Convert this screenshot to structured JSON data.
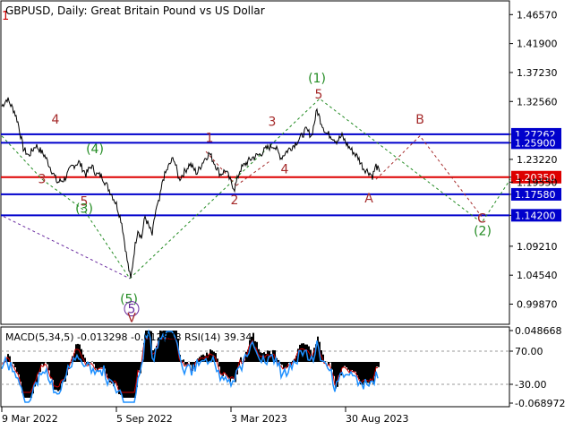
{
  "header": {
    "title": "GBPUSD, Daily:  Great Britain Pound vs US Dollar",
    "corner_mark": "1"
  },
  "colors": {
    "background": "#ffffff",
    "price": "#000000",
    "hline_blue": "#0000cc",
    "hline_red": "#dd0000",
    "wave_brown": "#a52a2a",
    "wave_green": "#228b22",
    "wave_purple": "#6a2ca0",
    "macd_hist": "#000000",
    "macd_signal": "#cc0000",
    "rsi": "#1e90ff"
  },
  "chart_data": [
    {
      "type": "line",
      "name": "main-price-chart",
      "ylim": [
        0.9662,
        1.4878
      ],
      "y_ticks": [
        "1.46570",
        "1.41900",
        "1.37230",
        "1.32560",
        "1.27262",
        "1.25900",
        "1.23220",
        "1.20350",
        "1.19550",
        "1.17580",
        "1.14200",
        "1.09210",
        "1.04540",
        "0.99870"
      ],
      "x_ticks": [
        "9 Mar 2022",
        "5 Sep 2022",
        "3 Mar 2023",
        "30 Aug 2023"
      ],
      "price_path": [
        {
          "i": 0,
          "y": 1.318
        },
        {
          "i": 6,
          "y": 1.33
        },
        {
          "i": 14,
          "y": 1.31
        },
        {
          "i": 18,
          "y": 1.292
        },
        {
          "i": 24,
          "y": 1.25
        },
        {
          "i": 30,
          "y": 1.238
        },
        {
          "i": 38,
          "y": 1.255
        },
        {
          "i": 48,
          "y": 1.238
        },
        {
          "i": 56,
          "y": 1.214
        },
        {
          "i": 62,
          "y": 1.195
        },
        {
          "i": 70,
          "y": 1.2
        },
        {
          "i": 78,
          "y": 1.22
        },
        {
          "i": 86,
          "y": 1.228
        },
        {
          "i": 94,
          "y": 1.208
        },
        {
          "i": 100,
          "y": 1.222
        },
        {
          "i": 106,
          "y": 1.208
        },
        {
          "i": 112,
          "y": 1.205
        },
        {
          "i": 118,
          "y": 1.188
        },
        {
          "i": 122,
          "y": 1.178
        },
        {
          "i": 128,
          "y": 1.16
        },
        {
          "i": 134,
          "y": 1.13
        },
        {
          "i": 140,
          "y": 1.07
        },
        {
          "i": 144,
          "y": 1.038
        },
        {
          "i": 148,
          "y": 1.085
        },
        {
          "i": 152,
          "y": 1.12
        },
        {
          "i": 156,
          "y": 1.105
        },
        {
          "i": 160,
          "y": 1.14
        },
        {
          "i": 164,
          "y": 1.125
        },
        {
          "i": 168,
          "y": 1.11
        },
        {
          "i": 172,
          "y": 1.15
        },
        {
          "i": 176,
          "y": 1.165
        },
        {
          "i": 180,
          "y": 1.2
        },
        {
          "i": 186,
          "y": 1.22
        },
        {
          "i": 192,
          "y": 1.235
        },
        {
          "i": 198,
          "y": 1.2
        },
        {
          "i": 204,
          "y": 1.212
        },
        {
          "i": 210,
          "y": 1.225
        },
        {
          "i": 218,
          "y": 1.21
        },
        {
          "i": 226,
          "y": 1.232
        },
        {
          "i": 232,
          "y": 1.242
        },
        {
          "i": 238,
          "y": 1.225
        },
        {
          "i": 244,
          "y": 1.208
        },
        {
          "i": 250,
          "y": 1.215
        },
        {
          "i": 256,
          "y": 1.195
        },
        {
          "i": 260,
          "y": 1.185
        },
        {
          "i": 266,
          "y": 1.215
        },
        {
          "i": 272,
          "y": 1.225
        },
        {
          "i": 280,
          "y": 1.235
        },
        {
          "i": 288,
          "y": 1.24
        },
        {
          "i": 296,
          "y": 1.25
        },
        {
          "i": 304,
          "y": 1.255
        },
        {
          "i": 312,
          "y": 1.235
        },
        {
          "i": 318,
          "y": 1.245
        },
        {
          "i": 326,
          "y": 1.255
        },
        {
          "i": 334,
          "y": 1.268
        },
        {
          "i": 340,
          "y": 1.28
        },
        {
          "i": 346,
          "y": 1.27
        },
        {
          "i": 352,
          "y": 1.312
        },
        {
          "i": 356,
          "y": 1.295
        },
        {
          "i": 362,
          "y": 1.275
        },
        {
          "i": 368,
          "y": 1.27
        },
        {
          "i": 374,
          "y": 1.262
        },
        {
          "i": 380,
          "y": 1.27
        },
        {
          "i": 386,
          "y": 1.255
        },
        {
          "i": 392,
          "y": 1.245
        },
        {
          "i": 398,
          "y": 1.235
        },
        {
          "i": 404,
          "y": 1.218
        },
        {
          "i": 410,
          "y": 1.212
        },
        {
          "i": 414,
          "y": 1.205
        },
        {
          "i": 418,
          "y": 1.222
        },
        {
          "i": 422,
          "y": 1.212
        }
      ],
      "levels": [
        {
          "price": "1.27262",
          "value": 1.27262,
          "color": "blue"
        },
        {
          "price": "1.25900",
          "value": 1.259,
          "color": "blue"
        },
        {
          "price": "1.20350",
          "value": 1.2035,
          "color": "red"
        },
        {
          "price": "1.17580",
          "value": 1.1758,
          "color": "blue"
        },
        {
          "price": "1.14200",
          "value": 1.142,
          "color": "blue"
        }
      ],
      "wave_labels": [
        {
          "text": "4",
          "i": 60,
          "y": 1.29,
          "color": "brown"
        },
        {
          "text": "3",
          "i": 45,
          "y": 1.194,
          "color": "brown"
        },
        {
          "text": "5",
          "i": 92,
          "y": 1.158,
          "color": "brown"
        },
        {
          "text": "(4)",
          "i": 104,
          "y": 1.242,
          "color": "green"
        },
        {
          "text": "(3)",
          "i": 92,
          "y": 1.146,
          "color": "green"
        },
        {
          "text": "1",
          "i": 232,
          "y": 1.26,
          "color": "brown"
        },
        {
          "text": "2",
          "i": 260,
          "y": 1.16,
          "color": "brown"
        },
        {
          "text": "3",
          "i": 302,
          "y": 1.286,
          "color": "brown"
        },
        {
          "text": "4",
          "i": 316,
          "y": 1.21,
          "color": "brown"
        },
        {
          "text": "(1)",
          "i": 352,
          "y": 1.356,
          "color": "green"
        },
        {
          "text": "5",
          "i": 354,
          "y": 1.33,
          "color": "brown"
        },
        {
          "text": "A",
          "i": 410,
          "y": 1.163,
          "color": "brown"
        },
        {
          "text": "B",
          "i": 467,
          "y": 1.29,
          "color": "brown"
        },
        {
          "text": "C",
          "i": 536,
          "y": 1.13,
          "color": "brown"
        },
        {
          "text": "(2)",
          "i": 537,
          "y": 1.11,
          "color": "green"
        },
        {
          "text": "(5)",
          "i": 142,
          "y": 1.0,
          "color": "green"
        },
        {
          "text": "5",
          "i": 145,
          "y": 0.984,
          "color": "purple"
        },
        {
          "text": "V",
          "i": 145,
          "y": 0.97,
          "color": "brown"
        }
      ]
    },
    {
      "type": "line",
      "name": "indicator-panel",
      "label": "MACD(5,34,5) -0.013298 -0.012848 RSI(14) 39.34",
      "y_ticks_right": [
        "0.048668",
        "70.00",
        "-30.00",
        "-0.068972"
      ]
    }
  ]
}
